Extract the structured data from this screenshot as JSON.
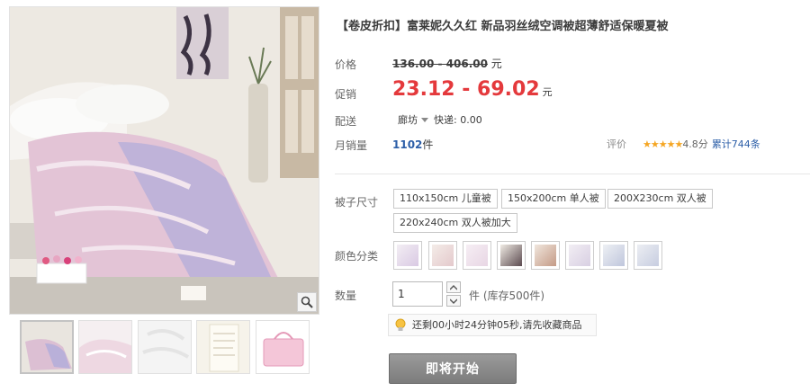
{
  "product": {
    "title": "【卷皮折扣】富莱妮久久红 新品羽丝绒空调被超薄舒适保暖夏被"
  },
  "price": {
    "label": "价格",
    "original": "136.00 - 406.00",
    "currency": "元"
  },
  "promo": {
    "label": "促销",
    "price": "23.12 - 69.02",
    "currency": "元"
  },
  "shipping": {
    "label": "配送",
    "location": "廊坊",
    "fee_text": "快递: 0.00"
  },
  "sales": {
    "label": "月销量",
    "count": "1102",
    "unit": "件"
  },
  "rating": {
    "label": "评价",
    "stars": "★★★★★",
    "score": "4.8分",
    "reviews": "累计744条"
  },
  "size": {
    "label": "被子尺寸",
    "options": [
      "110x150cm 儿童被",
      "150x200cm 单人被",
      "200X230cm 双人被",
      "220x240cm 双人被加大"
    ]
  },
  "color": {
    "label": "颜色分类",
    "swatches": [
      "#d9c9e3",
      "#e4c9cc",
      "#e8d6e4",
      "#5b4a4f",
      "#c49a86",
      "#d8cfe2",
      "#bfc6dc",
      "#c7cde0",
      "#c8b4a9"
    ]
  },
  "quantity": {
    "label": "数量",
    "value": "1",
    "stock": "件 (库存500件)"
  },
  "tip": {
    "text": "还剩00小时24分钟05秒,请先收藏商品"
  },
  "buy": {
    "label": "即将开始"
  },
  "icons": {
    "zoom": "magnifier-icon",
    "tip": "lightbulb-icon"
  }
}
